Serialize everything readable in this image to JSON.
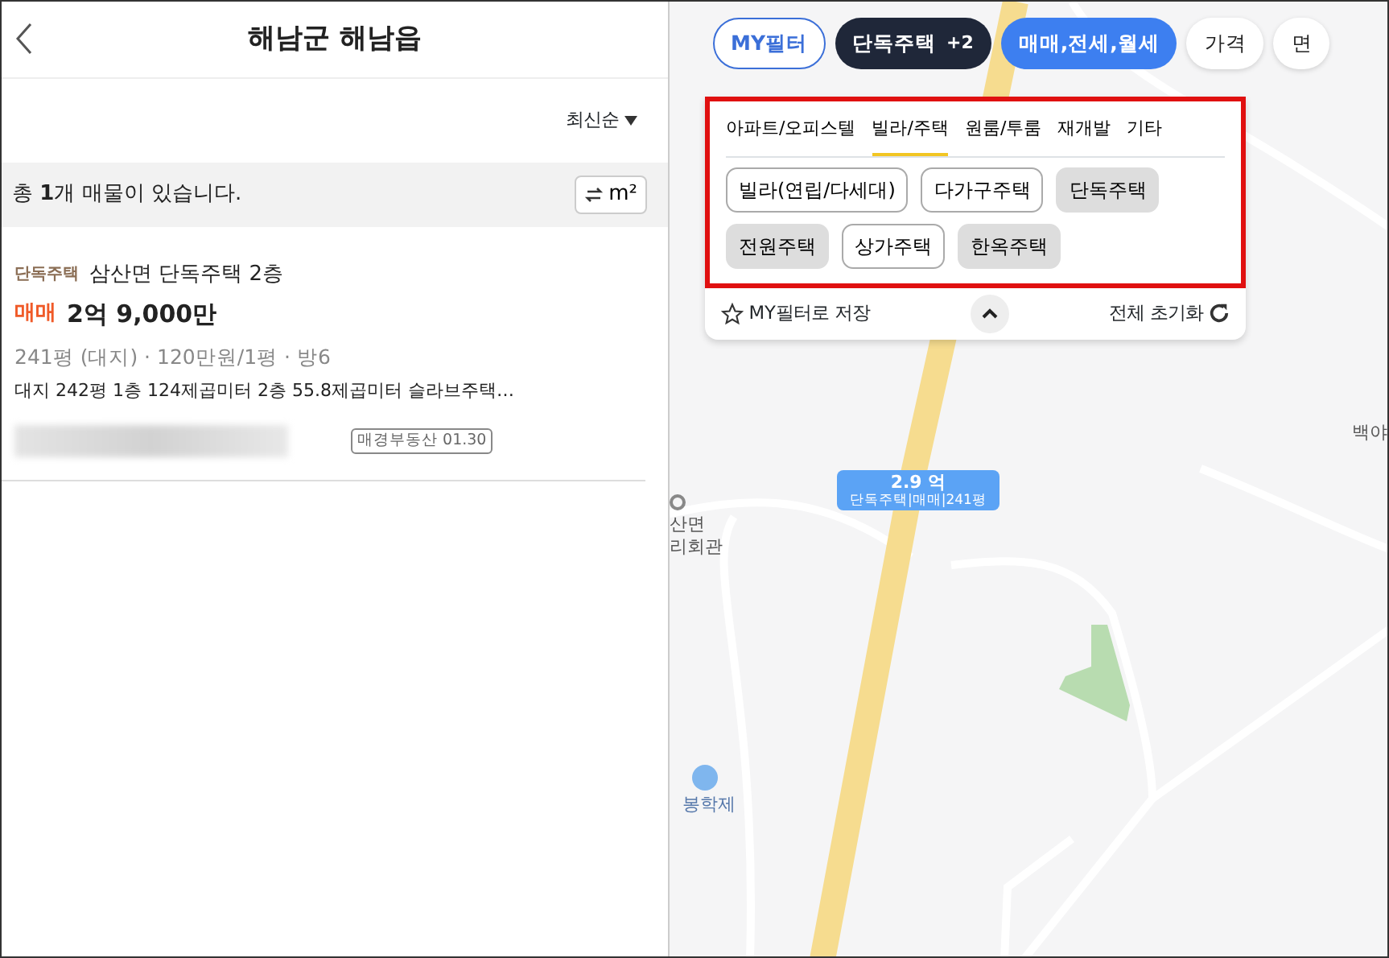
{
  "header": {
    "title": "해남군 해남읍"
  },
  "sort": {
    "label": "최신순"
  },
  "summary": {
    "text": "총 **1**개 매물이 있습니다.",
    "unit_toggle": "m²"
  },
  "listings": [
    {
      "type_tag": "단독주택",
      "title": "삼산면 단독주택 2층",
      "deal": "매매",
      "price": "2억 9,000만",
      "specs": "241평 (대지) · 120만원/1평 · 방6",
      "description": "대지 242평 1층 124제곱미터 2층 55.8제곱미터 슬라브주택…",
      "agency_tag": "매경부동산 01.30"
    }
  ],
  "filter_chips": [
    {
      "label": "MY필터",
      "kind": "outline"
    },
    {
      "label": "단독주택",
      "extra": "+2",
      "kind": "dark"
    },
    {
      "label": "매매,전세,월세",
      "kind": "primary"
    },
    {
      "label": "가격",
      "kind": "plain"
    },
    {
      "label": "면",
      "kind": "plain"
    }
  ],
  "category_tabs": [
    {
      "label": "아파트/오피스텔",
      "selected": false
    },
    {
      "label": "빌라/주택",
      "selected": true
    },
    {
      "label": "원룸/투룸",
      "selected": false
    },
    {
      "label": "재개발",
      "selected": false
    },
    {
      "label": "기타",
      "selected": false
    }
  ],
  "house_types": [
    {
      "label": "빌라(연립/다세대)",
      "selected": false
    },
    {
      "label": "다가구주택",
      "selected": false
    },
    {
      "label": "단독주택",
      "selected": true
    },
    {
      "label": "전원주택",
      "selected": true
    },
    {
      "label": "상가주택",
      "selected": false
    },
    {
      "label": "한옥주택",
      "selected": true
    }
  ],
  "filter_footer": {
    "save": "MY필터로 저장",
    "reset": "전체 초기화"
  },
  "map": {
    "marker": {
      "price": "2.9 억",
      "detail": "단독주택|매매|241평"
    },
    "places": [
      {
        "lines": [
          "산면",
          "리회관"
        ],
        "kind": "hall"
      },
      {
        "lines": [
          "봉학제"
        ],
        "kind": "reservoir"
      },
      {
        "lines": [
          "백야"
        ],
        "kind": "plain"
      }
    ]
  }
}
